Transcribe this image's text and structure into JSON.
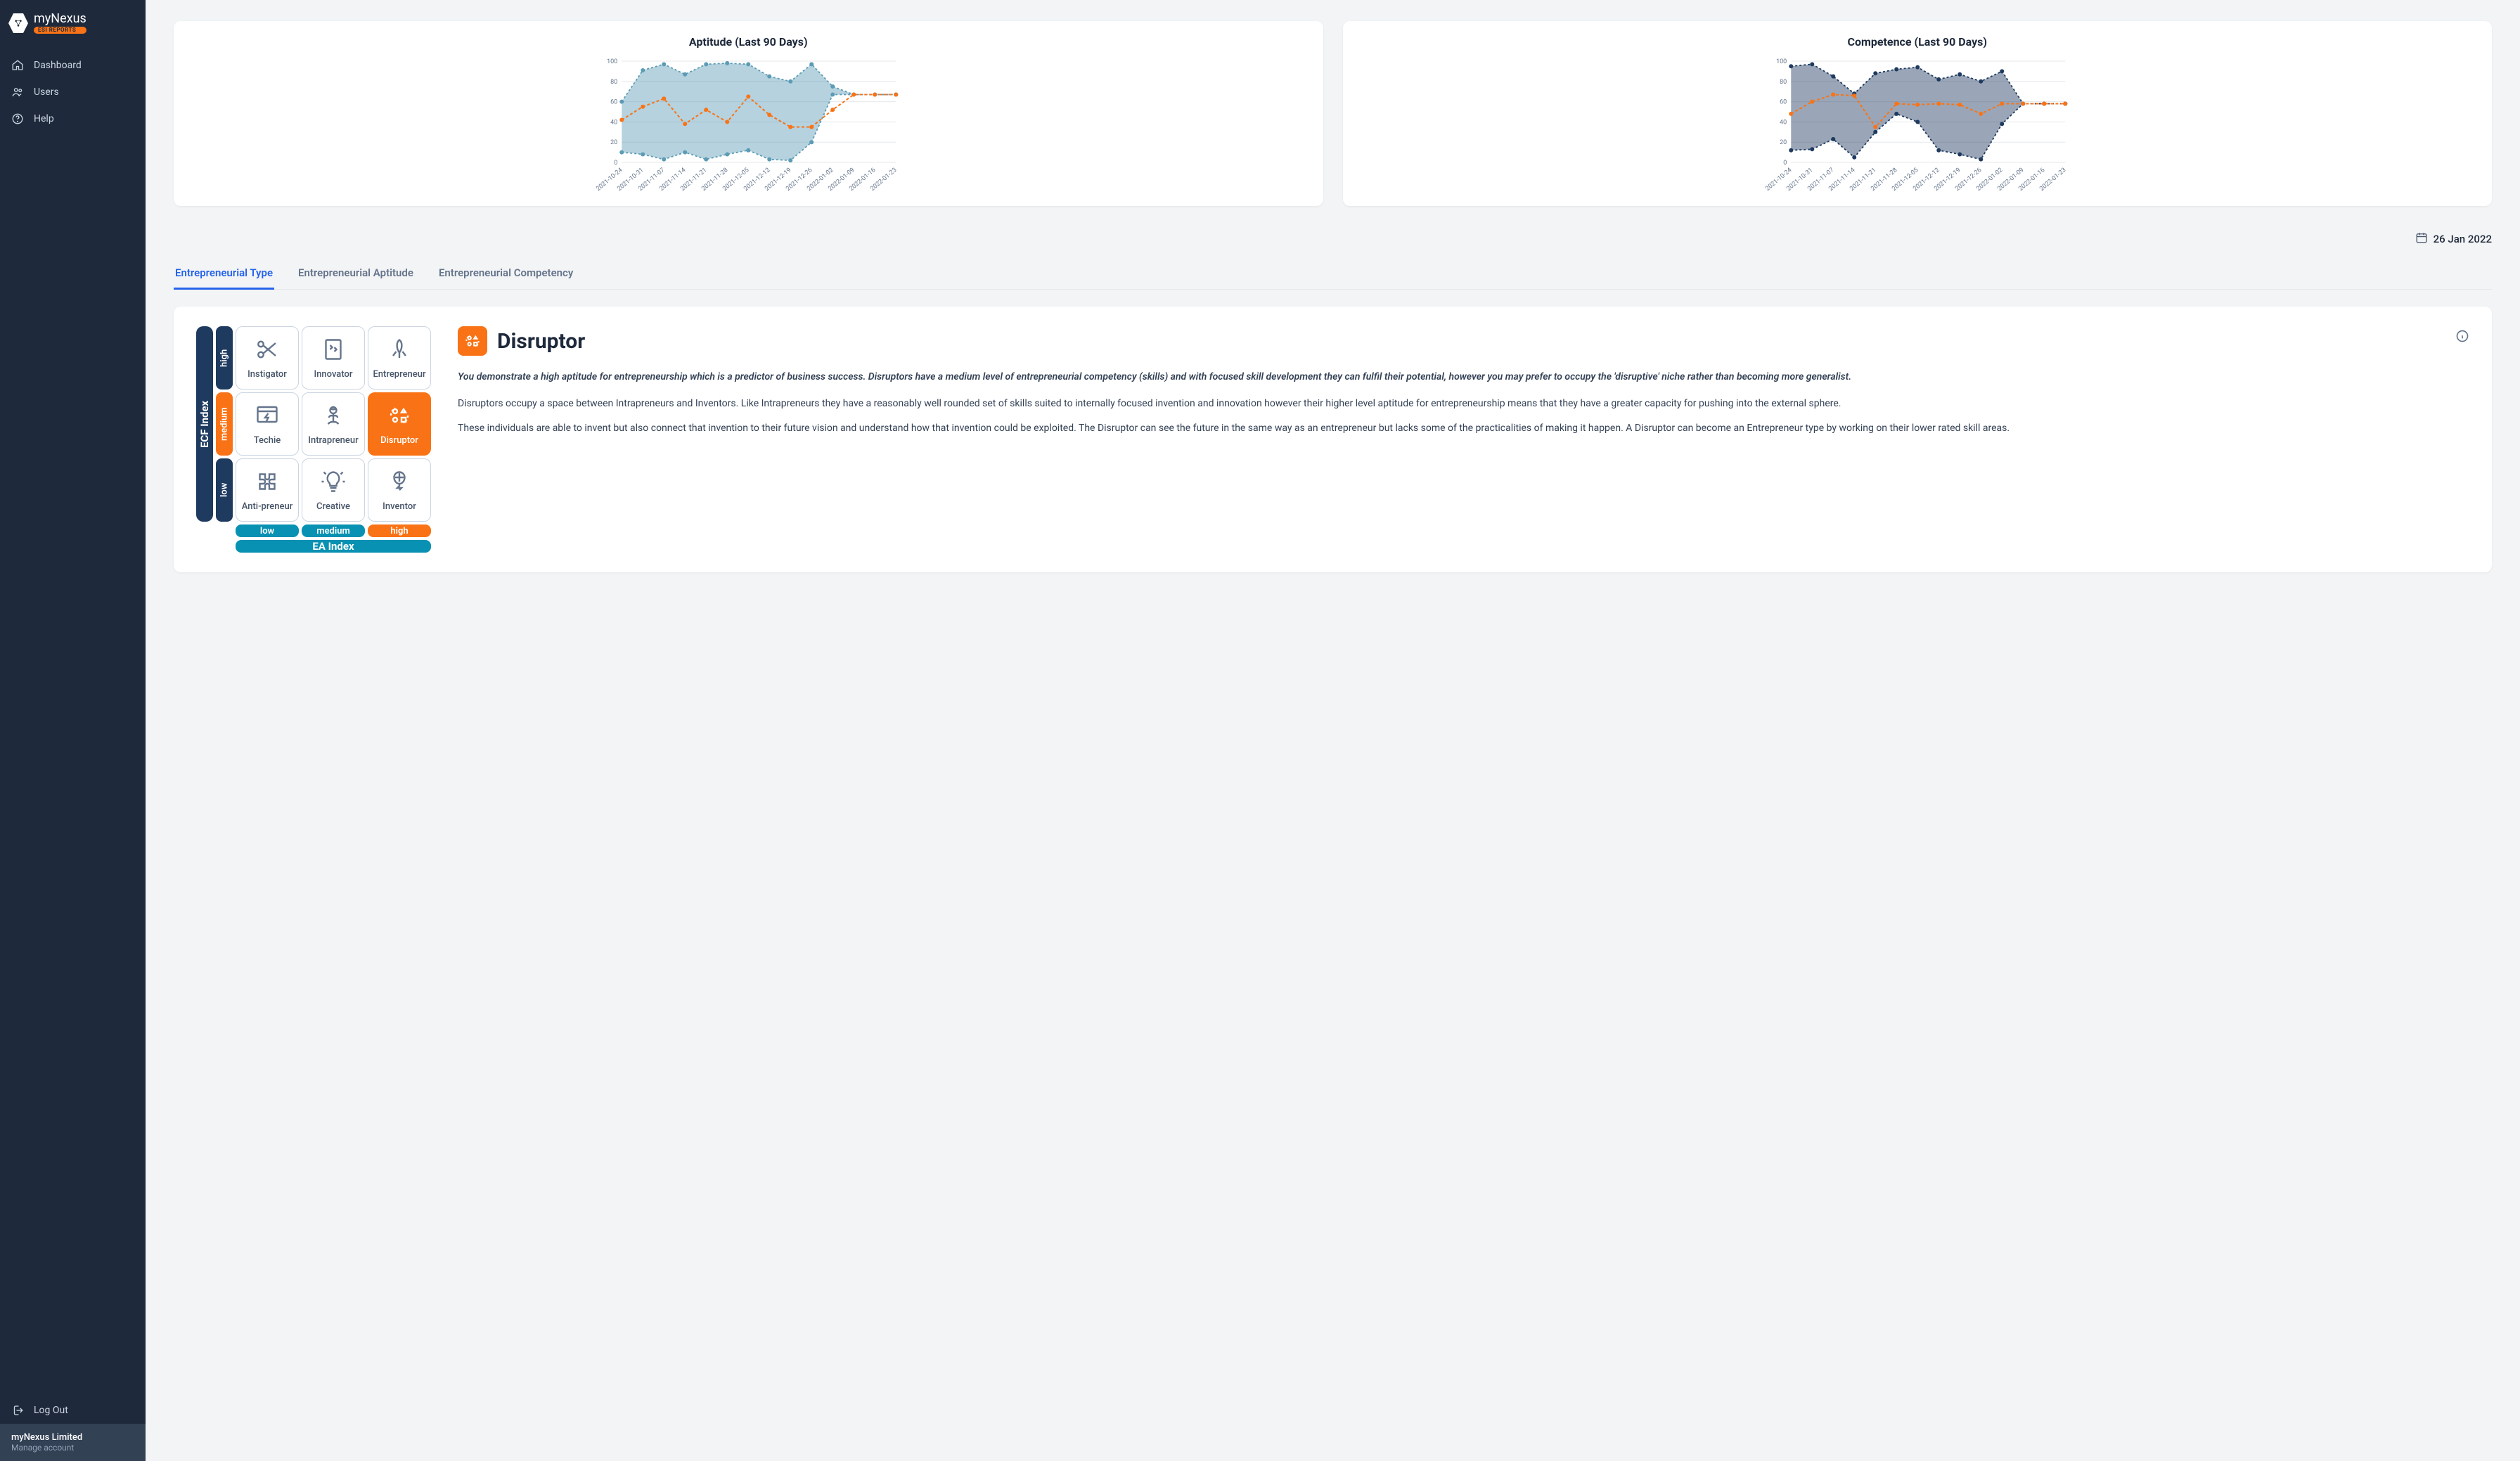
{
  "brand": {
    "name": "myNexus",
    "badge": "ESI REPORTS"
  },
  "nav": {
    "dashboard": "Dashboard",
    "users": "Users",
    "help": "Help",
    "logout": "Log Out"
  },
  "account": {
    "name": "myNexus Limited",
    "manage": "Manage account"
  },
  "date_label": "26 Jan 2022",
  "tabs": {
    "type": "Entrepreneurial Type",
    "aptitude": "Entrepreneurial Aptitude",
    "competency": "Entrepreneurial Competency"
  },
  "matrix": {
    "ecf_label": "ECF Index",
    "ea_label": "EA Index",
    "high": "high",
    "medium": "medium",
    "low": "low",
    "types": {
      "instigator": "Instigator",
      "innovator": "Innovator",
      "entrepreneur": "Entrepreneur",
      "techie": "Techie",
      "intrapreneur": "Intrapreneur",
      "disruptor": "Disruptor",
      "antipreneur": "Anti-preneur",
      "creative": "Creative",
      "inventor": "Inventor"
    }
  },
  "detail": {
    "title": "Disruptor",
    "intro": "You demonstrate a high aptitude for entrepreneurship which is a predictor of business success. Disruptors have a medium level of entrepreneurial competency (skills) and with focused skill development they can fulfil their potential, however you may prefer to occupy the 'disruptive' niche rather than becoming more generalist.",
    "p1": "Disruptors occupy a space between Intrapreneurs and Inventors. Like Intrapreneurs they have a reasonably well rounded set of skills suited to internally focused invention and innovation however their higher level aptitude for entrepreneurship means that they have a greater capacity for pushing into the external sphere.",
    "p2": "These individuals are able to invent but also connect that invention to their future vision and understand how that invention could be exploited. The Disruptor can see the future in the same way as an entrepreneur but lacks some of the practicalities of making it happen. A Disruptor can become an Entrepreneur type by working on their lower rated skill areas."
  },
  "chart_data": [
    {
      "type": "area",
      "title": "Aptitude (Last 90 Days)",
      "ylim": [
        0,
        100
      ],
      "yticks": [
        0,
        20,
        40,
        60,
        80,
        100
      ],
      "categories": [
        "2021-10-24",
        "2021-10-31",
        "2021-11-07",
        "2021-11-14",
        "2021-11-21",
        "2021-11-28",
        "2021-12-05",
        "2021-12-12",
        "2021-12-19",
        "2021-12-26",
        "2022-01-02",
        "2022-01-09",
        "2022-01-16",
        "2022-01-23"
      ],
      "series": [
        {
          "name": "upper",
          "color": "#5b9bb5",
          "values": [
            60,
            91,
            97,
            87,
            97,
            98,
            97,
            85,
            80,
            97,
            75,
            67,
            67,
            67
          ]
        },
        {
          "name": "lower",
          "color": "#5b9bb5",
          "values": [
            10,
            8,
            3,
            10,
            3,
            8,
            12,
            3,
            2,
            20,
            67,
            67,
            67,
            67
          ]
        },
        {
          "name": "mean",
          "color": "#f97316",
          "values": [
            42,
            55,
            63,
            38,
            52,
            40,
            65,
            47,
            35,
            35,
            52,
            67,
            67,
            67
          ]
        }
      ]
    },
    {
      "type": "area",
      "title": "Competence (Last 90 Days)",
      "ylim": [
        0,
        100
      ],
      "yticks": [
        0,
        20,
        40,
        60,
        80,
        100
      ],
      "categories": [
        "2021-10-24",
        "2021-10-31",
        "2021-11-07",
        "2021-11-14",
        "2021-11-21",
        "2021-11-28",
        "2021-12-05",
        "2021-12-12",
        "2021-12-19",
        "2021-12-26",
        "2022-01-02",
        "2022-01-09",
        "2022-01-16",
        "2022-01-23"
      ],
      "series": [
        {
          "name": "upper",
          "color": "#1e3a5f",
          "values": [
            95,
            97,
            85,
            68,
            88,
            92,
            94,
            82,
            87,
            80,
            90,
            58,
            58,
            58
          ]
        },
        {
          "name": "lower",
          "color": "#1e3a5f",
          "values": [
            12,
            13,
            23,
            5,
            30,
            48,
            40,
            12,
            8,
            3,
            38,
            58,
            58,
            58
          ]
        },
        {
          "name": "mean",
          "color": "#f97316",
          "values": [
            48,
            60,
            67,
            66,
            35,
            58,
            57,
            58,
            57,
            48,
            58,
            58,
            58,
            58
          ]
        }
      ]
    }
  ]
}
